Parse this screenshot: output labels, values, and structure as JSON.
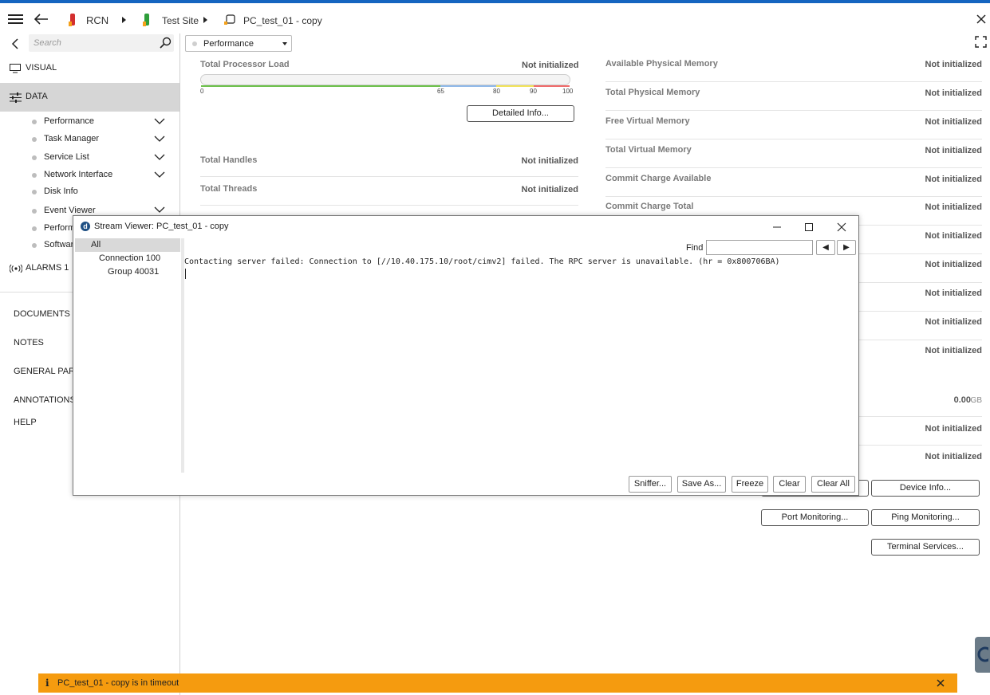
{
  "header": {
    "crumb1": "RCN",
    "crumb2": "Test Site",
    "crumb3": "PC_test_01 - copy"
  },
  "sidebar": {
    "search_placeholder": "Search",
    "visual": "VISUAL",
    "data": "DATA",
    "items": [
      {
        "label": "Performance"
      },
      {
        "label": "Task Manager"
      },
      {
        "label": "Service List"
      },
      {
        "label": "Network Interface"
      },
      {
        "label": "Disk Info"
      },
      {
        "label": "Event Viewer"
      },
      {
        "label": "Perform"
      },
      {
        "label": "Softwar"
      }
    ],
    "alarms": "ALARMS 1",
    "sections": [
      "DOCUMENTS",
      "NOTES",
      "GENERAL PARA",
      "ANNOTATIONS",
      "HELP"
    ]
  },
  "main": {
    "dropdown": "Performance",
    "processor": {
      "label": "Total Processor Load",
      "value": "Not initialized",
      "ticks": [
        "0",
        "65",
        "80",
        "90",
        "100"
      ],
      "detail_button": "Detailed Info..."
    },
    "left_stats": [
      {
        "label": "Total Handles",
        "value": "Not initialized"
      },
      {
        "label": "Total Threads",
        "value": "Not initialized"
      }
    ],
    "right_stats": [
      {
        "label": "Available Physical Memory",
        "value": "Not initialized"
      },
      {
        "label": "Total Physical Memory",
        "value": "Not initialized"
      },
      {
        "label": "Free Virtual Memory",
        "value": "Not initialized"
      },
      {
        "label": "Total Virtual Memory",
        "value": "Not initialized"
      },
      {
        "label": "Commit Charge Available",
        "value": "Not initialized"
      },
      {
        "label": "Commit Charge Total",
        "value": "Not initialized"
      },
      {
        "label": "",
        "value": "Not initialized"
      },
      {
        "label": "",
        "value": "Not initialized"
      },
      {
        "label": "",
        "value": "Not initialized"
      },
      {
        "label": "",
        "value": "Not initialized"
      },
      {
        "label": "",
        "value": "Not initialized"
      }
    ],
    "gb_value": "0.00",
    "gb_unit": "GB",
    "right_stats2": [
      {
        "label": "",
        "value": "Not initialized"
      },
      {
        "label": "",
        "value": "Not initialized"
      }
    ],
    "buttons": {
      "device_info": "Device Info...",
      "port_monitoring": "Port Monitoring...",
      "ping_monitoring": "Ping Monitoring...",
      "terminal_services": "Terminal Services..."
    }
  },
  "dialog": {
    "title": "Stream Viewer: PC_test_01 - copy",
    "app_icon_letter": "d",
    "tree": [
      "All",
      "Connection 100",
      "Group 40031"
    ],
    "find_label": "Find",
    "find_value": "",
    "message": "Contacting server failed: Connection to [//10.40.175.10/root/cimv2] failed. The RPC server is unavailable. (hr = 0x800706BA)",
    "buttons": [
      "Sniffer...",
      "Save As...",
      "Freeze",
      "Clear",
      "Clear All"
    ]
  },
  "banner": {
    "icon": "i",
    "text": "PC_test_01 - copy is in timeout"
  }
}
